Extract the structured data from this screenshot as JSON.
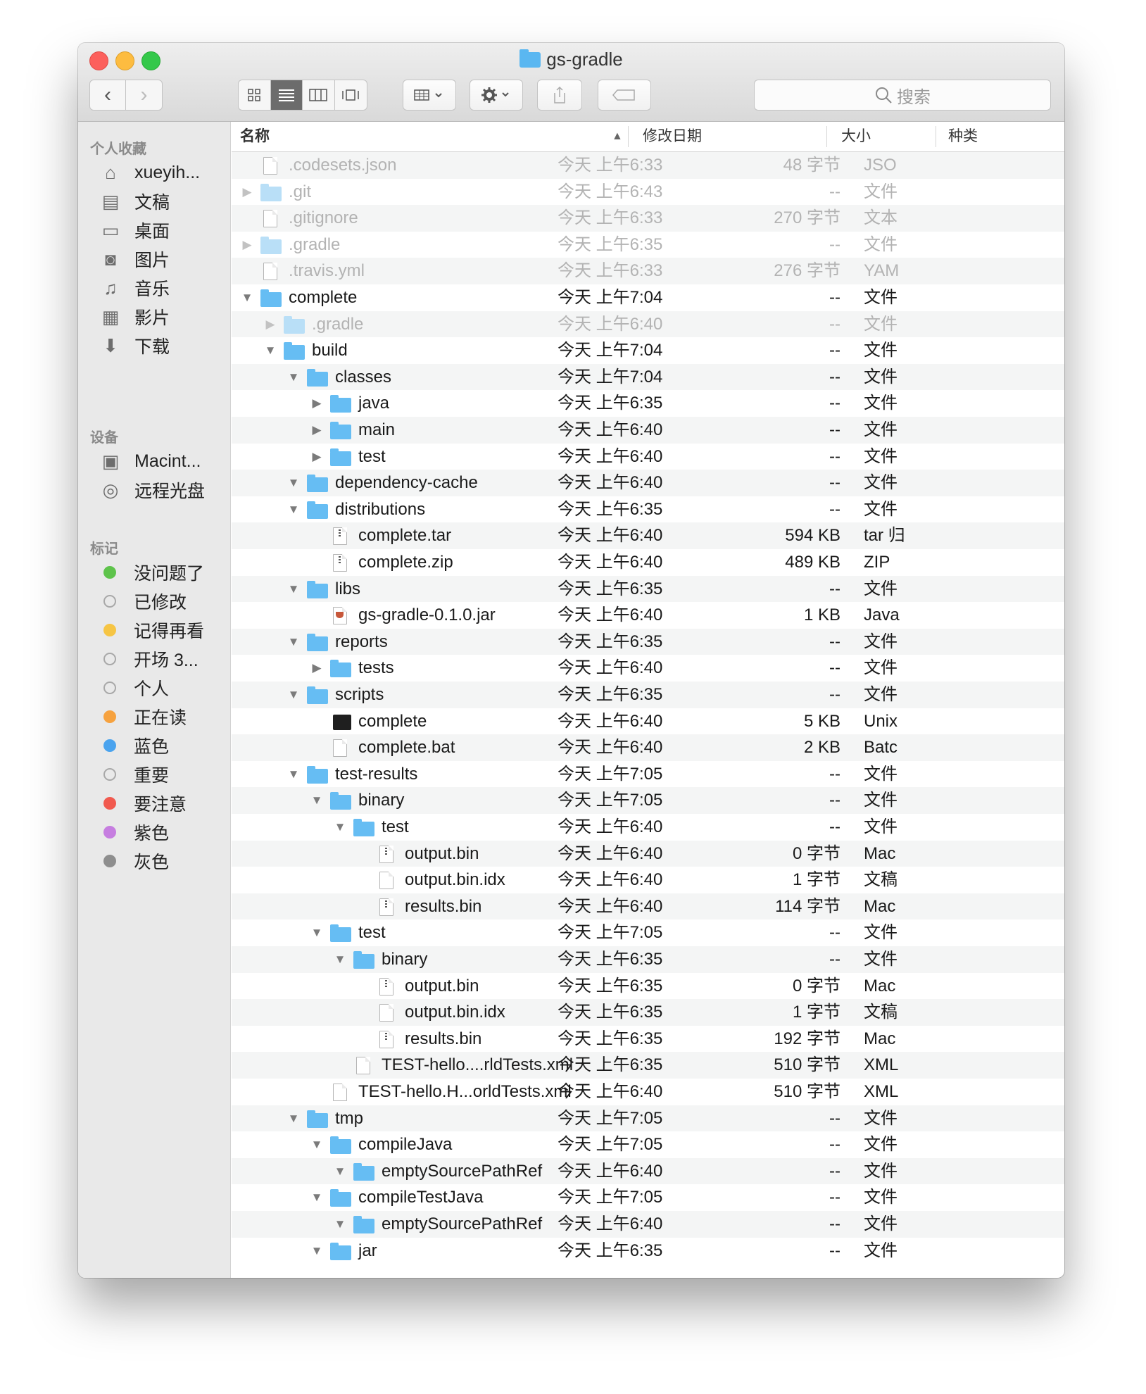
{
  "window": {
    "title": "gs-gradle"
  },
  "toolbar": {
    "back": "‹",
    "forward": "›",
    "views": [
      "icon",
      "list",
      "column",
      "coverflow"
    ],
    "search_placeholder": "搜索"
  },
  "sidebar": {
    "favorites_title": "个人收藏",
    "favorites": [
      {
        "label": "xueyih...",
        "icon": "home-icon"
      },
      {
        "label": "文稿",
        "icon": "documents-icon"
      },
      {
        "label": "桌面",
        "icon": "desktop-icon"
      },
      {
        "label": "图片",
        "icon": "camera-icon"
      },
      {
        "label": "音乐",
        "icon": "music-icon"
      },
      {
        "label": "影片",
        "icon": "film-icon"
      },
      {
        "label": "下载",
        "icon": "download-icon"
      }
    ],
    "devices_title": "设备",
    "devices": [
      {
        "label": "Macint...",
        "icon": "disk-icon"
      },
      {
        "label": "远程光盘",
        "icon": "optical-disc-icon"
      }
    ],
    "tags_title": "标记",
    "tags": [
      {
        "label": "没问题了",
        "color": "#5ec34b"
      },
      {
        "label": "已修改",
        "color": ""
      },
      {
        "label": "记得再看",
        "color": "#f6c544"
      },
      {
        "label": "开场 3...",
        "color": ""
      },
      {
        "label": "个人",
        "color": ""
      },
      {
        "label": "正在读",
        "color": "#f6a23f"
      },
      {
        "label": "蓝色",
        "color": "#4aa3ee"
      },
      {
        "label": "重要",
        "color": ""
      },
      {
        "label": "要注意",
        "color": "#f15a4f"
      },
      {
        "label": "紫色",
        "color": "#c67ee0"
      },
      {
        "label": "灰色",
        "color": "#8e8e8e"
      }
    ]
  },
  "columns": {
    "name": "名称",
    "date": "修改日期",
    "size": "大小",
    "kind": "种类"
  },
  "files": [
    {
      "name": ".codesets.json",
      "date": "今天 上午6:33",
      "size": "48 字节",
      "kind": "JSO",
      "depth": 0,
      "tri": "",
      "icon": "file",
      "dim": true
    },
    {
      "name": ".git",
      "date": "今天 上午6:43",
      "size": "--",
      "kind": "文件",
      "depth": 0,
      "tri": "▶",
      "icon": "folder",
      "dim": true
    },
    {
      "name": ".gitignore",
      "date": "今天 上午6:33",
      "size": "270 字节",
      "kind": "文本",
      "depth": 0,
      "tri": "",
      "icon": "file",
      "dim": true
    },
    {
      "name": ".gradle",
      "date": "今天 上午6:35",
      "size": "--",
      "kind": "文件",
      "depth": 0,
      "tri": "▶",
      "icon": "folder",
      "dim": true
    },
    {
      "name": ".travis.yml",
      "date": "今天 上午6:33",
      "size": "276 字节",
      "kind": "YAM",
      "depth": 0,
      "tri": "",
      "icon": "file",
      "dim": true
    },
    {
      "name": "complete",
      "date": "今天 上午7:04",
      "size": "--",
      "kind": "文件",
      "depth": 0,
      "tri": "▼",
      "icon": "folder",
      "dim": false
    },
    {
      "name": ".gradle",
      "date": "今天 上午6:40",
      "size": "--",
      "kind": "文件",
      "depth": 1,
      "tri": "▶",
      "icon": "folder",
      "dim": true
    },
    {
      "name": "build",
      "date": "今天 上午7:04",
      "size": "--",
      "kind": "文件",
      "depth": 1,
      "tri": "▼",
      "icon": "folder",
      "dim": false
    },
    {
      "name": "classes",
      "date": "今天 上午7:04",
      "size": "--",
      "kind": "文件",
      "depth": 2,
      "tri": "▼",
      "icon": "folder",
      "dim": false
    },
    {
      "name": "java",
      "date": "今天 上午6:35",
      "size": "--",
      "kind": "文件",
      "depth": 3,
      "tri": "▶",
      "icon": "folder",
      "dim": false
    },
    {
      "name": "main",
      "date": "今天 上午6:40",
      "size": "--",
      "kind": "文件",
      "depth": 3,
      "tri": "▶",
      "icon": "folder",
      "dim": false
    },
    {
      "name": "test",
      "date": "今天 上午6:40",
      "size": "--",
      "kind": "文件",
      "depth": 3,
      "tri": "▶",
      "icon": "folder",
      "dim": false
    },
    {
      "name": "dependency-cache",
      "date": "今天 上午6:40",
      "size": "--",
      "kind": "文件",
      "depth": 2,
      "tri": "▼",
      "icon": "folder",
      "dim": false
    },
    {
      "name": "distributions",
      "date": "今天 上午6:35",
      "size": "--",
      "kind": "文件",
      "depth": 2,
      "tri": "▼",
      "icon": "folder",
      "dim": false
    },
    {
      "name": "complete.tar",
      "date": "今天 上午6:40",
      "size": "594 KB",
      "kind": "tar 归",
      "depth": 3,
      "tri": "",
      "icon": "zip",
      "dim": false
    },
    {
      "name": "complete.zip",
      "date": "今天 上午6:40",
      "size": "489 KB",
      "kind": "ZIP",
      "depth": 3,
      "tri": "",
      "icon": "zip",
      "dim": false
    },
    {
      "name": "libs",
      "date": "今天 上午6:35",
      "size": "--",
      "kind": "文件",
      "depth": 2,
      "tri": "▼",
      "icon": "folder",
      "dim": false
    },
    {
      "name": "gs-gradle-0.1.0.jar",
      "date": "今天 上午6:40",
      "size": "1 KB",
      "kind": "Java",
      "depth": 3,
      "tri": "",
      "icon": "jar",
      "dim": false
    },
    {
      "name": "reports",
      "date": "今天 上午6:35",
      "size": "--",
      "kind": "文件",
      "depth": 2,
      "tri": "▼",
      "icon": "folder",
      "dim": false
    },
    {
      "name": "tests",
      "date": "今天 上午6:40",
      "size": "--",
      "kind": "文件",
      "depth": 3,
      "tri": "▶",
      "icon": "folder",
      "dim": false
    },
    {
      "name": "scripts",
      "date": "今天 上午6:35",
      "size": "--",
      "kind": "文件",
      "depth": 2,
      "tri": "▼",
      "icon": "folder",
      "dim": false
    },
    {
      "name": "complete",
      "date": "今天 上午6:40",
      "size": "5 KB",
      "kind": "Unix",
      "depth": 3,
      "tri": "",
      "icon": "term",
      "dim": false
    },
    {
      "name": "complete.bat",
      "date": "今天 上午6:40",
      "size": "2 KB",
      "kind": "Batc",
      "depth": 3,
      "tri": "",
      "icon": "file",
      "dim": false
    },
    {
      "name": "test-results",
      "date": "今天 上午7:05",
      "size": "--",
      "kind": "文件",
      "depth": 2,
      "tri": "▼",
      "icon": "folder",
      "dim": false
    },
    {
      "name": "binary",
      "date": "今天 上午7:05",
      "size": "--",
      "kind": "文件",
      "depth": 3,
      "tri": "▼",
      "icon": "folder",
      "dim": false
    },
    {
      "name": "test",
      "date": "今天 上午6:40",
      "size": "--",
      "kind": "文件",
      "depth": 4,
      "tri": "▼",
      "icon": "folder",
      "dim": false
    },
    {
      "name": "output.bin",
      "date": "今天 上午6:40",
      "size": "0 字节",
      "kind": "Mac",
      "depth": 5,
      "tri": "",
      "icon": "zip",
      "dim": false
    },
    {
      "name": "output.bin.idx",
      "date": "今天 上午6:40",
      "size": "1 字节",
      "kind": "文稿",
      "depth": 5,
      "tri": "",
      "icon": "file",
      "dim": false
    },
    {
      "name": "results.bin",
      "date": "今天 上午6:40",
      "size": "114 字节",
      "kind": "Mac",
      "depth": 5,
      "tri": "",
      "icon": "zip",
      "dim": false
    },
    {
      "name": "test",
      "date": "今天 上午7:05",
      "size": "--",
      "kind": "文件",
      "depth": 3,
      "tri": "▼",
      "icon": "folder",
      "dim": false
    },
    {
      "name": "binary",
      "date": "今天 上午6:35",
      "size": "--",
      "kind": "文件",
      "depth": 4,
      "tri": "▼",
      "icon": "folder",
      "dim": false
    },
    {
      "name": "output.bin",
      "date": "今天 上午6:35",
      "size": "0 字节",
      "kind": "Mac",
      "depth": 5,
      "tri": "",
      "icon": "zip",
      "dim": false
    },
    {
      "name": "output.bin.idx",
      "date": "今天 上午6:35",
      "size": "1 字节",
      "kind": "文稿",
      "depth": 5,
      "tri": "",
      "icon": "file",
      "dim": false
    },
    {
      "name": "results.bin",
      "date": "今天 上午6:35",
      "size": "192 字节",
      "kind": "Mac",
      "depth": 5,
      "tri": "",
      "icon": "zip",
      "dim": false
    },
    {
      "name": "TEST-hello....rldTests.xml",
      "date": "今天 上午6:35",
      "size": "510 字节",
      "kind": "XML",
      "depth": 4,
      "tri": "",
      "icon": "file",
      "dim": false
    },
    {
      "name": "TEST-hello.H...orldTests.xml",
      "date": "今天 上午6:40",
      "size": "510 字节",
      "kind": "XML",
      "depth": 3,
      "tri": "",
      "icon": "file",
      "dim": false
    },
    {
      "name": "tmp",
      "date": "今天 上午7:05",
      "size": "--",
      "kind": "文件",
      "depth": 2,
      "tri": "▼",
      "icon": "folder",
      "dim": false
    },
    {
      "name": "compileJava",
      "date": "今天 上午7:05",
      "size": "--",
      "kind": "文件",
      "depth": 3,
      "tri": "▼",
      "icon": "folder",
      "dim": false
    },
    {
      "name": "emptySourcePathRef",
      "date": "今天 上午6:40",
      "size": "--",
      "kind": "文件",
      "depth": 4,
      "tri": "▼",
      "icon": "folder",
      "dim": false
    },
    {
      "name": "compileTestJava",
      "date": "今天 上午7:05",
      "size": "--",
      "kind": "文件",
      "depth": 3,
      "tri": "▼",
      "icon": "folder",
      "dim": false
    },
    {
      "name": "emptySourcePathRef",
      "date": "今天 上午6:40",
      "size": "--",
      "kind": "文件",
      "depth": 4,
      "tri": "▼",
      "icon": "folder",
      "dim": false
    },
    {
      "name": "jar",
      "date": "今天 上午6:35",
      "size": "--",
      "kind": "文件",
      "depth": 3,
      "tri": "▼",
      "icon": "folder",
      "dim": false
    }
  ]
}
